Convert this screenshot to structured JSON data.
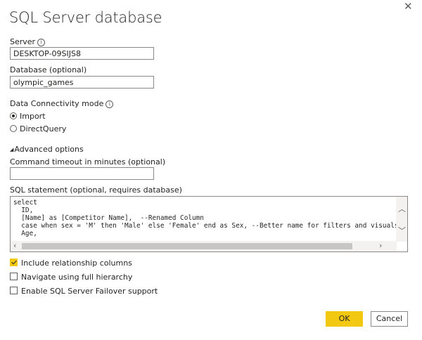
{
  "dialog": {
    "title": "SQL Server database",
    "close_glyph": "✕"
  },
  "server": {
    "label": "Server",
    "value": "DESKTOP-09SIJS8"
  },
  "database": {
    "label": "Database (optional)",
    "value": "olympic_games"
  },
  "connectivity": {
    "label": "Data Connectivity mode",
    "options": [
      {
        "label": "Import",
        "selected": true
      },
      {
        "label": "DirectQuery",
        "selected": false
      }
    ]
  },
  "advanced": {
    "toggle_label": "Advanced options",
    "timeout_label": "Command timeout in minutes (optional)",
    "timeout_value": "",
    "sql_label": "SQL statement (optional, requires database)",
    "sql_text": "select\n  ID,\n  [Name] as [Competitor Name],  --Renamed Column\n  case when sex = 'M' then 'Male' else 'Female' end as Sex, --Better name for filters and visuals\n  Age,"
  },
  "checkboxes": [
    {
      "label": "Include relationship columns",
      "checked": true
    },
    {
      "label": "Navigate using full hierarchy",
      "checked": false
    },
    {
      "label": "Enable SQL Server Failover support",
      "checked": false
    }
  ],
  "buttons": {
    "ok": "OK",
    "cancel": "Cancel"
  },
  "colors": {
    "accent": "#F2C811",
    "border": "#8A8886",
    "text": "#252423"
  }
}
